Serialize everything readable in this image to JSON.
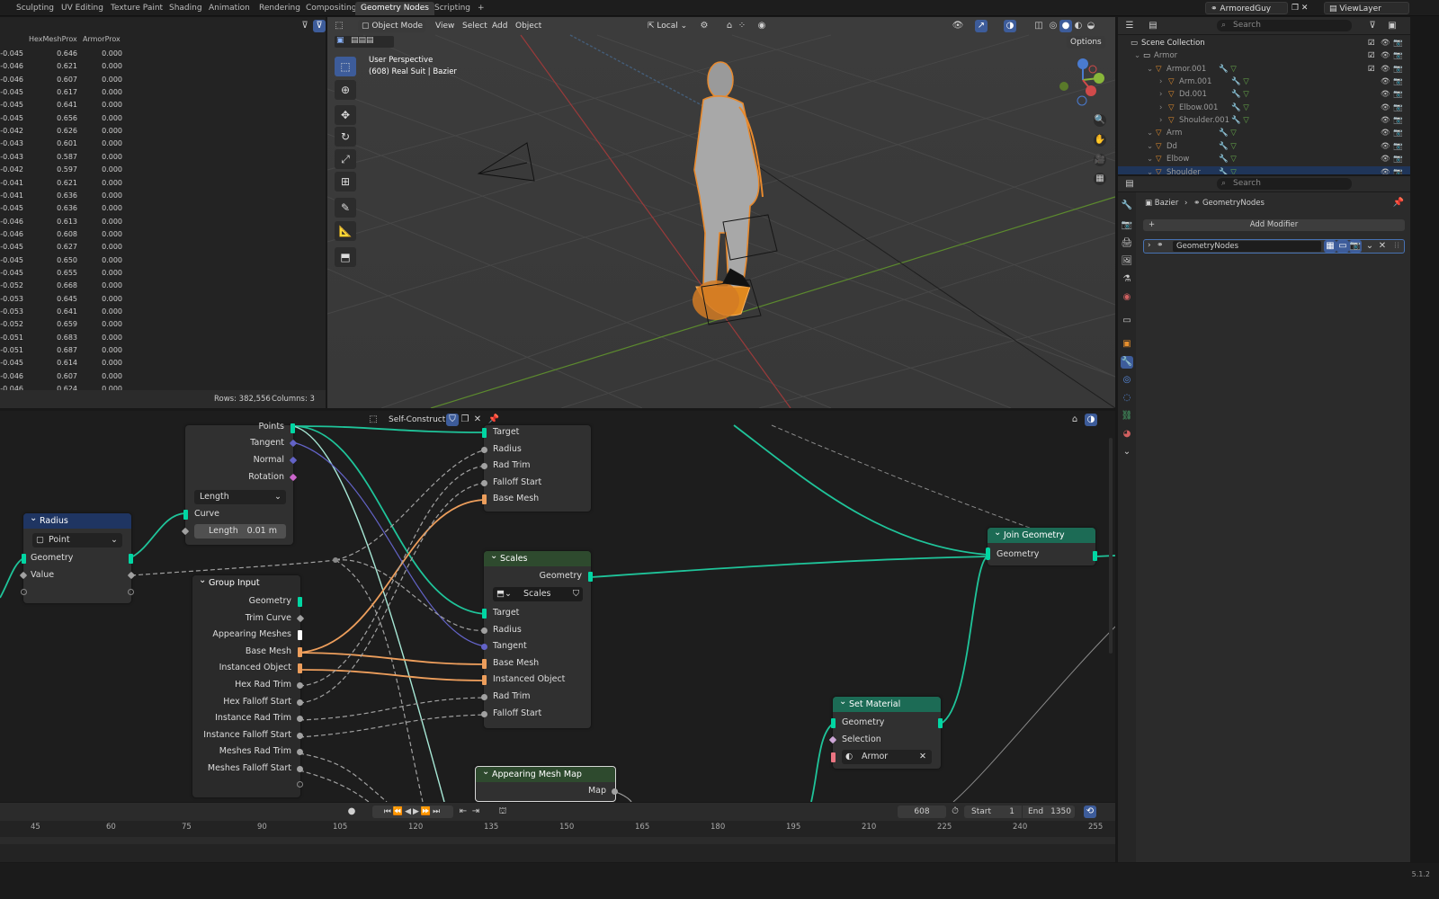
{
  "workspaces": [
    "Sculpting",
    "UV Editing",
    "Texture Paint",
    "Shading",
    "Animation",
    "Rendering",
    "Compositing",
    "Geometry Nodes",
    "Scripting"
  ],
  "workspace_active": 7,
  "add_workspace": "+",
  "topbar": {
    "scene": "ArmoredGuy",
    "view_layer": "ViewLayer"
  },
  "spreadsheet": {
    "columns": [
      "HexMeshProx",
      "ArmorProx"
    ],
    "rows": [
      [
        "-0.045",
        "0.646",
        "0.000"
      ],
      [
        "-0.046",
        "0.621",
        "0.000"
      ],
      [
        "-0.046",
        "0.607",
        "0.000"
      ],
      [
        "-0.045",
        "0.617",
        "0.000"
      ],
      [
        "-0.045",
        "0.641",
        "0.000"
      ],
      [
        "-0.045",
        "0.656",
        "0.000"
      ],
      [
        "-0.042",
        "0.626",
        "0.000"
      ],
      [
        "-0.043",
        "0.601",
        "0.000"
      ],
      [
        "-0.043",
        "0.587",
        "0.000"
      ],
      [
        "-0.042",
        "0.597",
        "0.000"
      ],
      [
        "-0.041",
        "0.621",
        "0.000"
      ],
      [
        "-0.041",
        "0.636",
        "0.000"
      ],
      [
        "-0.045",
        "0.636",
        "0.000"
      ],
      [
        "-0.046",
        "0.613",
        "0.000"
      ],
      [
        "-0.046",
        "0.608",
        "0.000"
      ],
      [
        "-0.045",
        "0.627",
        "0.000"
      ],
      [
        "-0.045",
        "0.650",
        "0.000"
      ],
      [
        "-0.045",
        "0.655",
        "0.000"
      ],
      [
        "-0.052",
        "0.668",
        "0.000"
      ],
      [
        "-0.053",
        "0.645",
        "0.000"
      ],
      [
        "-0.053",
        "0.641",
        "0.000"
      ],
      [
        "-0.052",
        "0.659",
        "0.000"
      ],
      [
        "-0.051",
        "0.683",
        "0.000"
      ],
      [
        "-0.051",
        "0.687",
        "0.000"
      ],
      [
        "-0.045",
        "0.614",
        "0.000"
      ],
      [
        "-0.046",
        "0.607",
        "0.000"
      ],
      [
        "-0.046",
        "0.624",
        "0.000"
      ]
    ],
    "rows_label": "Rows: 382,556",
    "columns_label": "Columns: 3"
  },
  "viewport": {
    "mode": "Object Mode",
    "menus": [
      "View",
      "Select",
      "Add",
      "Object"
    ],
    "orientation": "Local",
    "options": "Options",
    "info_line1": "User Perspective",
    "info_line2": "(608) Real Suit | Bazier"
  },
  "outliner": {
    "search_placeholder": "Search",
    "items": [
      {
        "label": "Scene Collection",
        "indent": 0
      },
      {
        "label": "Armor",
        "indent": 1
      },
      {
        "label": "Armor.001",
        "indent": 2
      },
      {
        "label": "Arm.001",
        "indent": 3
      },
      {
        "label": "Dd.001",
        "indent": 3
      },
      {
        "label": "Elbow.001",
        "indent": 3
      },
      {
        "label": "Shoulder.001",
        "indent": 3
      },
      {
        "label": "Arm",
        "indent": 2
      },
      {
        "label": "Dd",
        "indent": 2
      },
      {
        "label": "Elbow",
        "indent": 2
      },
      {
        "label": "Shoulder",
        "indent": 2
      }
    ]
  },
  "properties": {
    "search_placeholder": "Search",
    "breadcrumb_object": "Bazier",
    "breadcrumb_modifier": "GeometryNodes",
    "add_modifier": "Add Modifier",
    "modifier_name": "GeometryNodes"
  },
  "node_editor": {
    "tree_name": "Self-Construct",
    "nodes": {
      "top": {
        "outputs": [
          "Points",
          "Tangent",
          "Normal",
          "Rotation"
        ],
        "dropdown": "Length",
        "curve": "Curve",
        "length_label": "Length",
        "length_value": "0.01 m"
      },
      "radius": {
        "title": "Radius",
        "dropdown": "Point",
        "geometry": "Geometry",
        "value": "Value"
      },
      "group_input": {
        "title": "Group Input",
        "outputs": [
          "Geometry",
          "Trim Curve",
          "Appearing Meshes",
          "Base Mesh",
          "Instanced Object",
          "Hex Rad Trim",
          "Hex Falloff Start",
          "Instance Rad Trim",
          "Instance Falloff Start",
          "Meshes Rad Trim",
          "Meshes Falloff Start"
        ]
      },
      "hex": {
        "inputs": [
          "Target",
          "Radius",
          "Rad Trim",
          "Falloff Start",
          "Base Mesh"
        ]
      },
      "scales": {
        "title": "Scales",
        "output": "Geometry",
        "dropdown": "Scales",
        "inputs": [
          "Target",
          "Radius",
          "Tangent",
          "Base Mesh",
          "Instanced Object",
          "Rad Trim",
          "Falloff Start"
        ]
      },
      "join": {
        "title": "Join Geometry",
        "geometry": "Geometry"
      },
      "set_material": {
        "title": "Set Material",
        "geometry": "Geometry",
        "selection": "Selection",
        "material": "Armor"
      },
      "appearing": {
        "title": "Appearing Mesh Map",
        "output": "Map"
      }
    }
  },
  "timeline": {
    "current_frame": "608",
    "start_label": "Start",
    "start_value": "1",
    "end_label": "End",
    "end_value": "1350",
    "ticks": [
      "45",
      "60",
      "75",
      "90",
      "105",
      "120",
      "135",
      "150",
      "165",
      "180",
      "195",
      "210",
      "225",
      "240",
      "255"
    ]
  },
  "status": {
    "version": "5.1.2"
  },
  "colors": {
    "geometry": "#00d6a3",
    "float": "#a1a1a1",
    "vector": "#6363c7",
    "material": "#eb7582",
    "object": "#ed9e5c",
    "selection": "#cca6d6",
    "accent": "#4772b3"
  }
}
